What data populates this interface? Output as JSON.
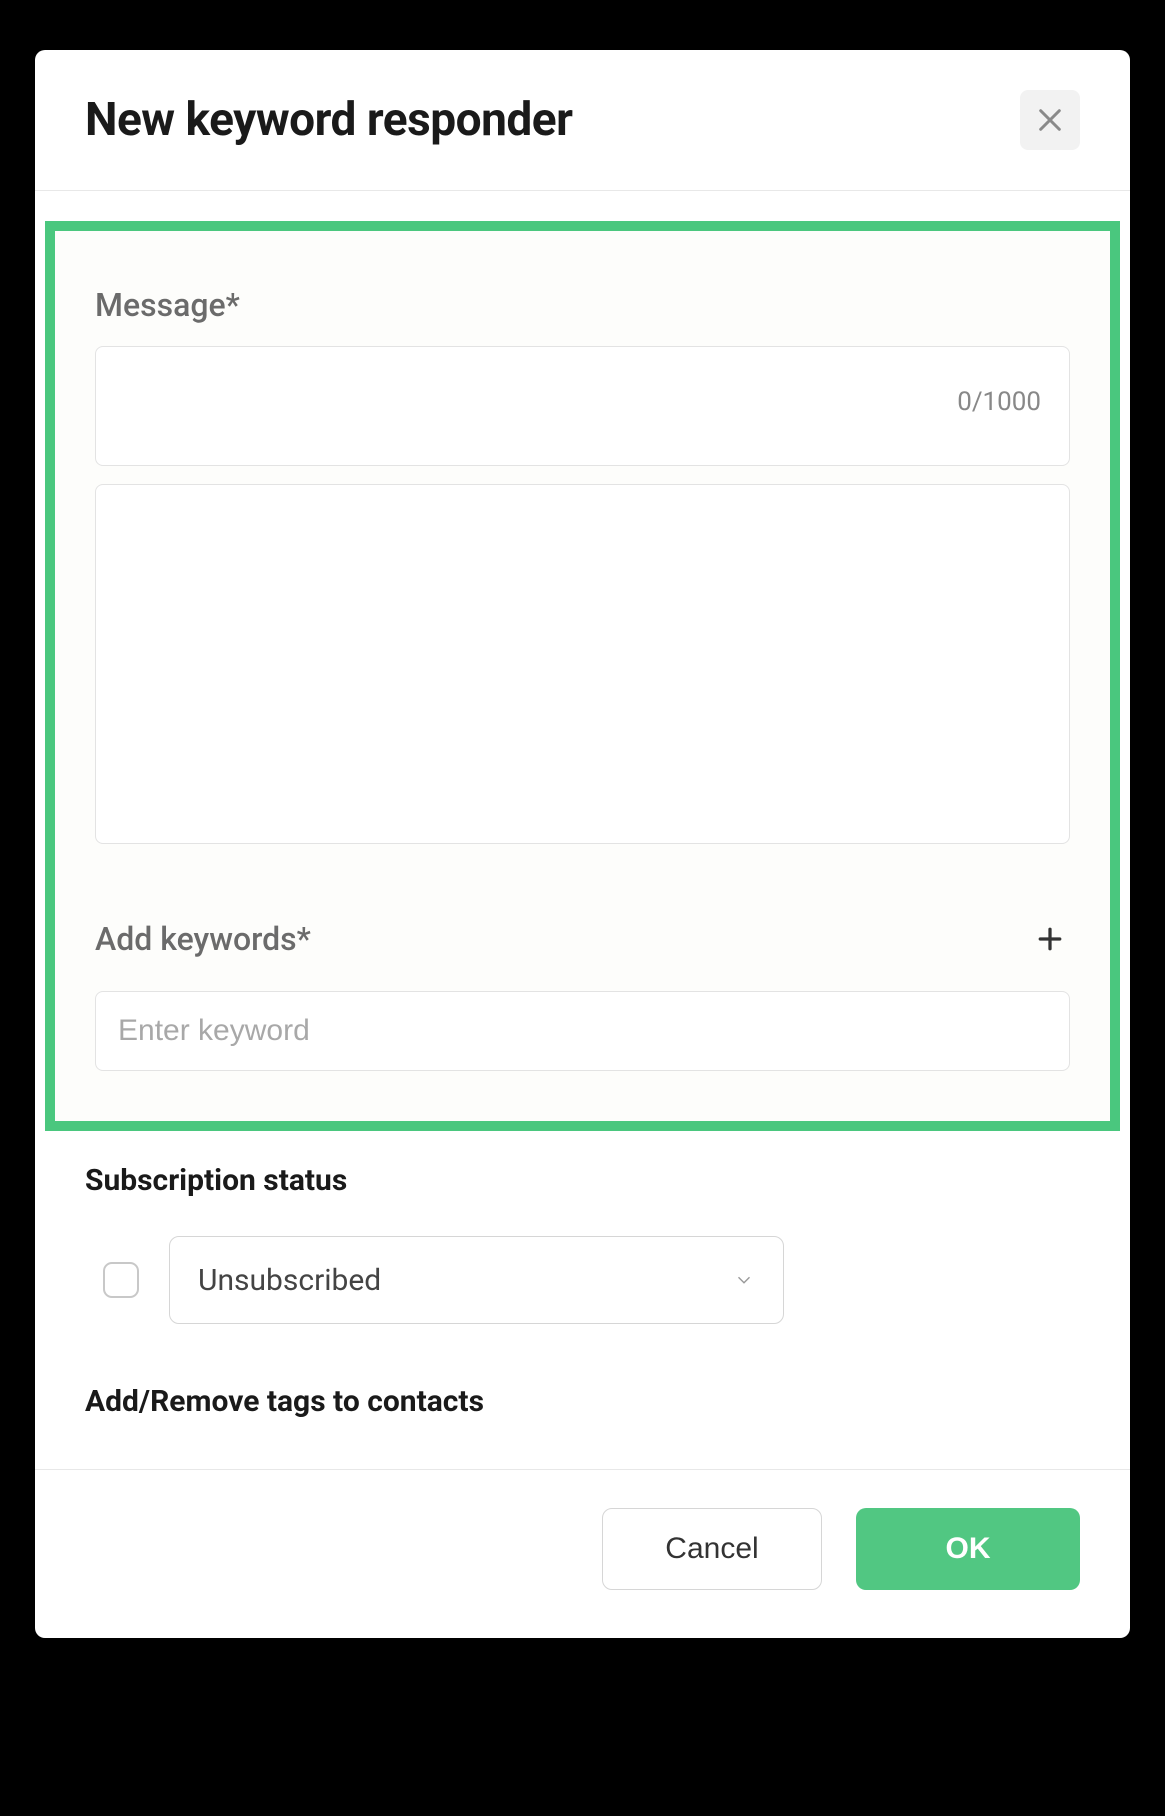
{
  "header": {
    "title": "New keyword responder"
  },
  "message": {
    "label": "Message*",
    "counter": "0/1000"
  },
  "keywords": {
    "label": "Add keywords*",
    "placeholder": "Enter keyword"
  },
  "subscription": {
    "title": "Subscription status",
    "selected": "Unsubscribed"
  },
  "tags": {
    "title": "Add/Remove tags to contacts"
  },
  "footer": {
    "cancel": "Cancel",
    "ok": "OK"
  }
}
